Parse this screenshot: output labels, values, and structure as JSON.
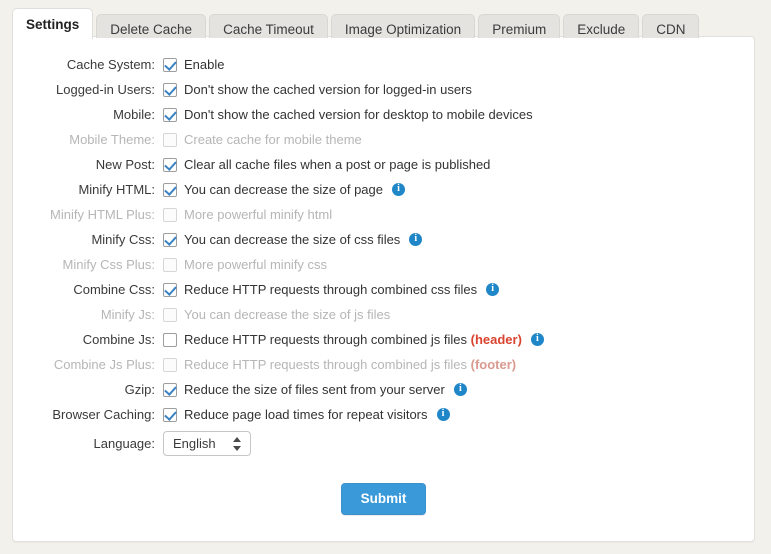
{
  "tabs": [
    {
      "label": "Settings",
      "active": true
    },
    {
      "label": "Delete Cache",
      "active": false
    },
    {
      "label": "Cache Timeout",
      "active": false
    },
    {
      "label": "Image Optimization",
      "active": false
    },
    {
      "label": "Premium",
      "active": false
    },
    {
      "label": "Exclude",
      "active": false
    },
    {
      "label": "CDN",
      "active": false
    }
  ],
  "colors": {
    "page_background": "#f2f1ec",
    "panel_background": "#ffffff",
    "tab_inactive": "#e4e3e0",
    "checkbox_check": "#3a82c4",
    "info_icon": "#1f86c8",
    "submit_button": "#3a9ad9",
    "hint_red": "#d9432f",
    "disabled_text": "#b6b6b6"
  },
  "form": {
    "rows": [
      {
        "label": "Cache System:",
        "text": "Enable",
        "checked": true,
        "disabled": false,
        "info": false
      },
      {
        "label": "Logged-in Users:",
        "text": "Don't show the cached version for logged-in users",
        "checked": true,
        "disabled": false,
        "info": false
      },
      {
        "label": "Mobile:",
        "text": "Don't show the cached version for desktop to mobile devices",
        "checked": true,
        "disabled": false,
        "info": false
      },
      {
        "label": "Mobile Theme:",
        "text": "Create cache for mobile theme",
        "checked": false,
        "disabled": true,
        "info": false
      },
      {
        "label": "New Post:",
        "text": "Clear all cache files when a post or page is published",
        "checked": true,
        "disabled": false,
        "info": false
      },
      {
        "label": "Minify HTML:",
        "text": "You can decrease the size of page",
        "checked": true,
        "disabled": false,
        "info": true
      },
      {
        "label": "Minify HTML Plus:",
        "text": "More powerful minify html",
        "checked": false,
        "disabled": true,
        "info": false
      },
      {
        "label": "Minify Css:",
        "text": "You can decrease the size of css files",
        "checked": true,
        "disabled": false,
        "info": true
      },
      {
        "label": "Minify Css Plus:",
        "text": "More powerful minify css",
        "checked": false,
        "disabled": true,
        "info": false
      },
      {
        "label": "Combine Css:",
        "text": "Reduce HTTP requests through combined css files",
        "checked": true,
        "disabled": false,
        "info": true
      },
      {
        "label": "Minify Js:",
        "text": "You can decrease the size of js files",
        "checked": false,
        "disabled": true,
        "info": false
      },
      {
        "label": "Combine Js:",
        "text": "Reduce HTTP requests through combined js files",
        "hint": "(header)",
        "checked": false,
        "disabled": false,
        "info": true
      },
      {
        "label": "Combine Js Plus:",
        "text": "Reduce HTTP requests through combined js files",
        "hint": "(footer)",
        "checked": false,
        "disabled": true,
        "info": false
      },
      {
        "label": "Gzip:",
        "text": "Reduce the size of files sent from your server",
        "checked": true,
        "disabled": false,
        "info": true
      },
      {
        "label": "Browser Caching:",
        "text": "Reduce page load times for repeat visitors",
        "checked": true,
        "disabled": false,
        "info": true
      }
    ],
    "language": {
      "label": "Language:",
      "value": "English",
      "options": [
        "English"
      ]
    },
    "submit_label": "Submit"
  }
}
